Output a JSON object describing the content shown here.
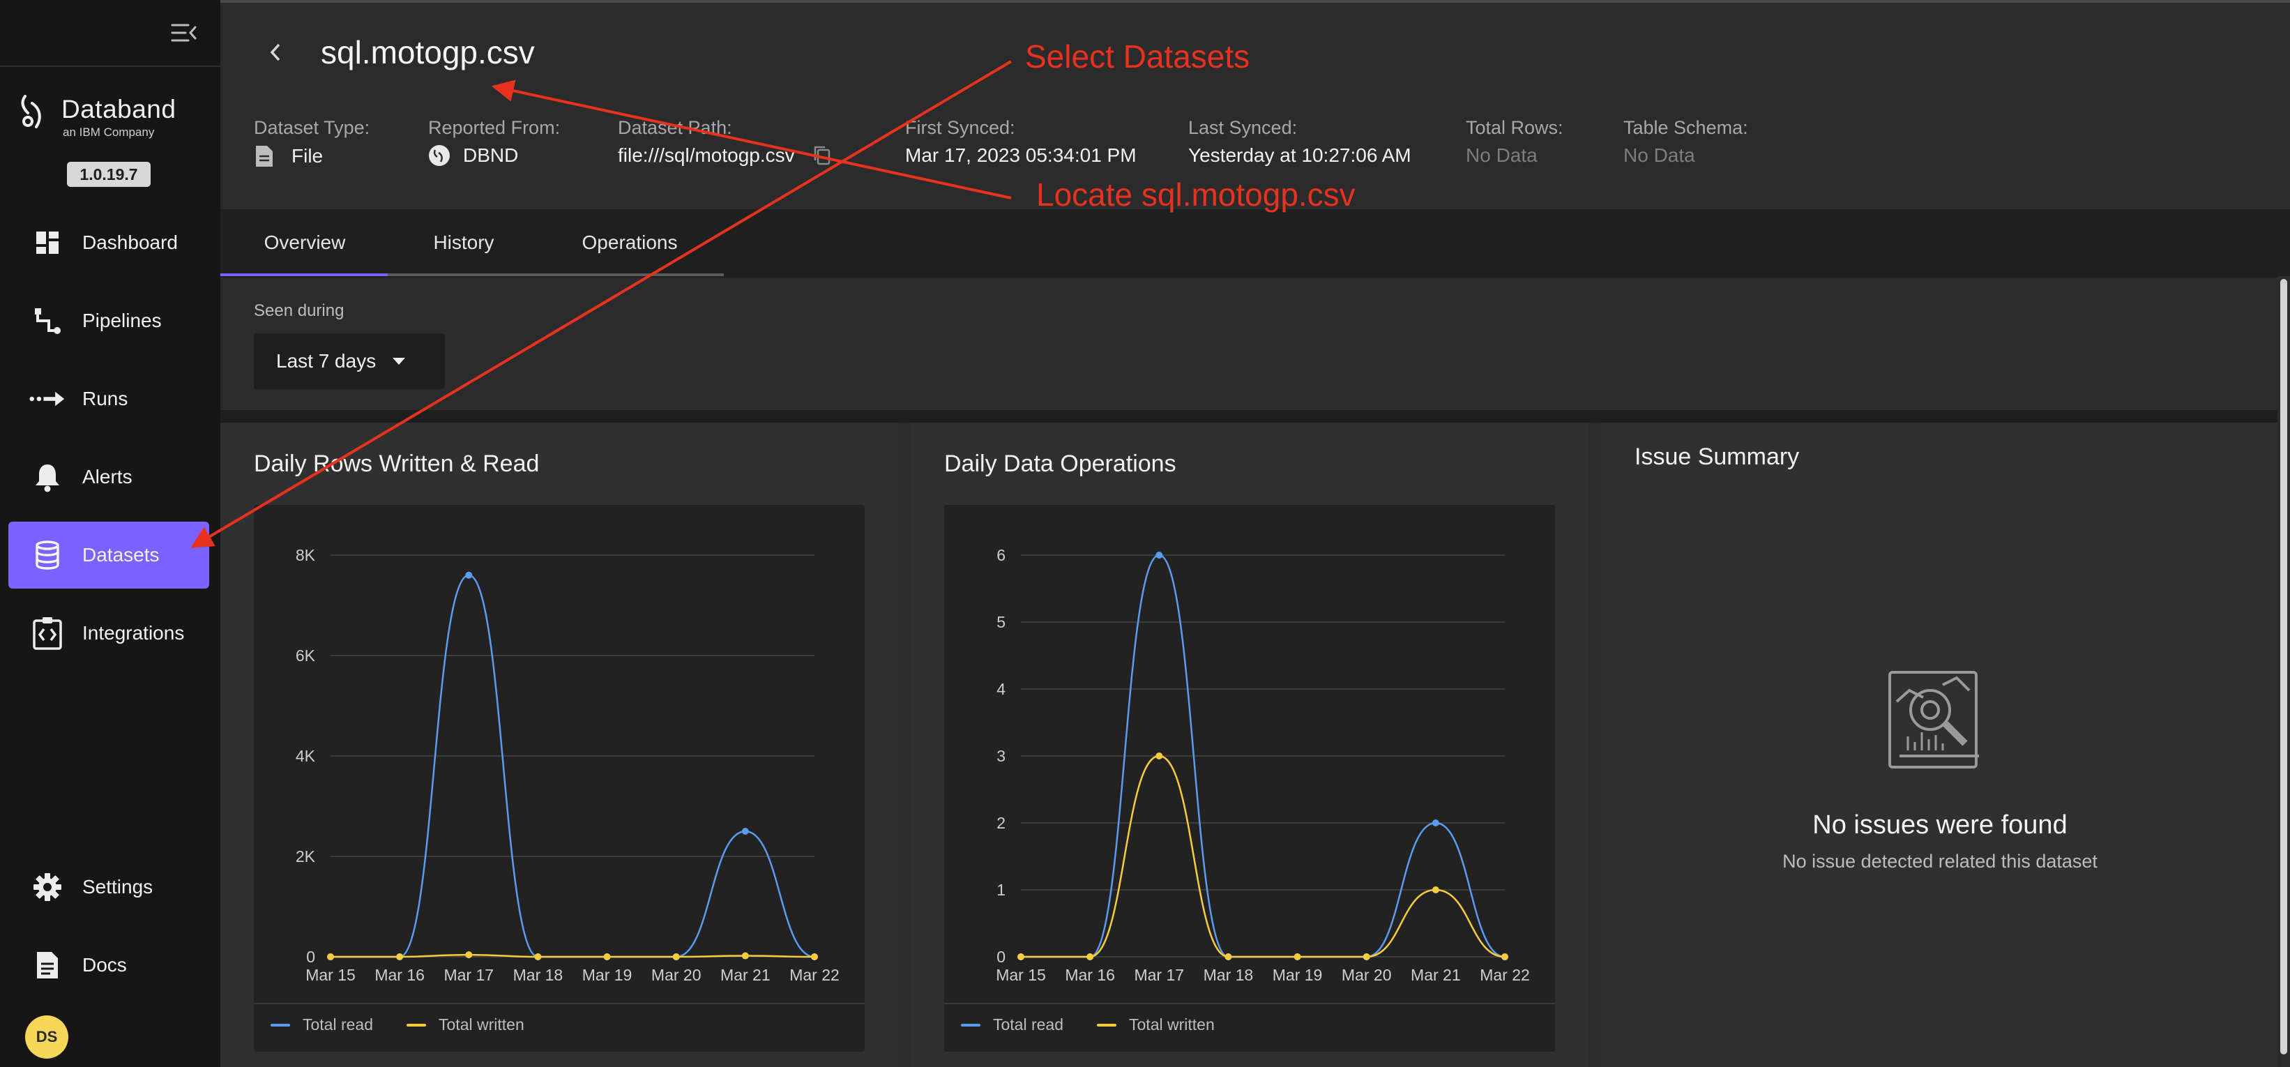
{
  "sidebar": {
    "logo": {
      "name": "Databand",
      "tagline": "an IBM Company"
    },
    "version": "1.0.19.7",
    "items": [
      {
        "label": "Dashboard",
        "icon": "dashboard-icon"
      },
      {
        "label": "Pipelines",
        "icon": "pipelines-icon"
      },
      {
        "label": "Runs",
        "icon": "runs-icon"
      },
      {
        "label": "Alerts",
        "icon": "bell-icon"
      },
      {
        "label": "Datasets",
        "icon": "database-icon",
        "active": true
      },
      {
        "label": "Integrations",
        "icon": "integrations-icon"
      }
    ],
    "bottom_items": [
      {
        "label": "Settings",
        "icon": "gear-icon"
      },
      {
        "label": "Docs",
        "icon": "document-icon"
      }
    ],
    "avatar_initials": "DS"
  },
  "header": {
    "title": "sql.motogp.csv",
    "meta": [
      {
        "label": "Dataset Type:",
        "value": "File"
      },
      {
        "label": "Reported From:",
        "value": "DBND"
      },
      {
        "label": "Dataset Path:",
        "value": "file:///sql/motogp.csv"
      },
      {
        "label": "First Synced:",
        "value": "Mar 17, 2023 05:34:01 PM"
      },
      {
        "label": "Last Synced:",
        "value": "Yesterday at 10:27:06 AM"
      },
      {
        "label": "Total Rows:",
        "value": "No Data"
      },
      {
        "label": "Table Schema:",
        "value": "No Data"
      }
    ]
  },
  "tabs": [
    {
      "label": "Overview",
      "active": true
    },
    {
      "label": "History"
    },
    {
      "label": "Operations"
    }
  ],
  "filter": {
    "label": "Seen during",
    "value": "Last 7 days"
  },
  "colors": {
    "accent": "#7b61ff",
    "read": "#5b9bf0",
    "written": "#f5cc3c",
    "annotation": "#e8321f"
  },
  "legend": {
    "read": "Total read",
    "written": "Total written"
  },
  "chart_data": [
    {
      "type": "line",
      "title": "Daily Rows Written & Read",
      "categories": [
        "Mar 15",
        "Mar 16",
        "Mar 17",
        "Mar 18",
        "Mar 19",
        "Mar 20",
        "Mar 21",
        "Mar 22"
      ],
      "yticks": [
        "0",
        "2K",
        "4K",
        "6K",
        "8K"
      ],
      "ylim": [
        0,
        8000
      ],
      "series": [
        {
          "name": "Total read",
          "values": [
            0,
            0,
            7600,
            0,
            0,
            0,
            2500,
            0
          ]
        },
        {
          "name": "Total written",
          "values": [
            0,
            0,
            40,
            0,
            0,
            0,
            20,
            0
          ]
        }
      ],
      "legend_position": "bottom-left",
      "grid": true
    },
    {
      "type": "line",
      "title": "Daily Data Operations",
      "categories": [
        "Mar 15",
        "Mar 16",
        "Mar 17",
        "Mar 18",
        "Mar 19",
        "Mar 20",
        "Mar 21",
        "Mar 22"
      ],
      "yticks": [
        "0",
        "1",
        "2",
        "3",
        "4",
        "5",
        "6"
      ],
      "ylim": [
        0,
        6
      ],
      "series": [
        {
          "name": "Total read",
          "values": [
            0,
            0,
            6,
            0,
            0,
            0,
            2,
            0
          ]
        },
        {
          "name": "Total written",
          "values": [
            0,
            0,
            3,
            0,
            0,
            0,
            1,
            0
          ]
        }
      ],
      "legend_position": "bottom-left",
      "grid": true
    }
  ],
  "issue_summary": {
    "title": "Issue Summary",
    "empty_title": "No issues were found",
    "empty_subtitle": "No issue detected related this dataset"
  },
  "annotations": [
    {
      "text": "Select Datasets"
    },
    {
      "text": "Locate sql.motogp.csv"
    }
  ]
}
